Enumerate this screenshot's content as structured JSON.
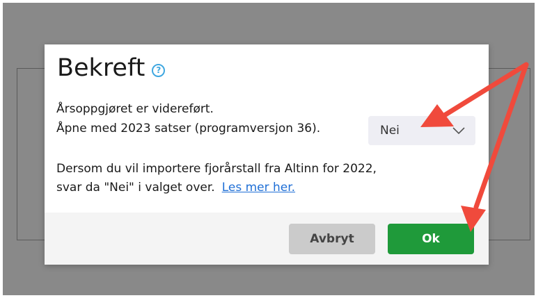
{
  "dialog": {
    "title": "Bekreft",
    "help_icon": "question-icon",
    "line1": "Årsoppgjøret er videreført.",
    "line2": "Åpne med 2023 satser (programversjon 36).",
    "select": {
      "value": "Nei"
    },
    "info_line1": "Dersom du vil importere fjorårstall fra Altinn for 2022,",
    "info_line2": "svar da \"Nei\" i valget over.",
    "link_text": "Les mer her.",
    "buttons": {
      "cancel": "Avbryt",
      "ok": "Ok"
    }
  },
  "colors": {
    "overlay": "#898989",
    "ok_button": "#1f9a3a",
    "cancel_button": "#cbcbcb",
    "link": "#1f6fd6",
    "help_icon": "#3fa7e0",
    "annotation_arrow": "#f04a3c"
  }
}
